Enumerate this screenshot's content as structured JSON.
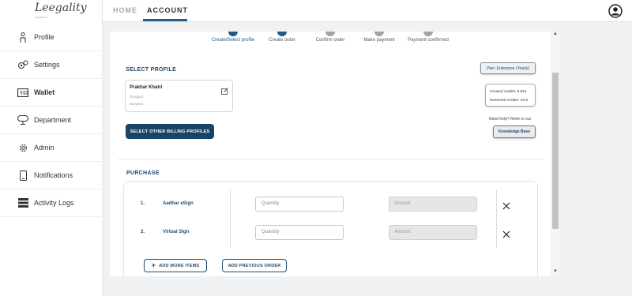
{
  "app": {
    "logo_text": "Leegality",
    "logo_sub": "LEEGALITY"
  },
  "sidebar": {
    "items": [
      {
        "label": "Profile",
        "icon": "person-icon"
      },
      {
        "label": "Settings",
        "icon": "gear-icon"
      },
      {
        "label": "Wallet",
        "icon": "wallet-icon",
        "active": true
      },
      {
        "label": "Department",
        "icon": "department-icon"
      },
      {
        "label": "Admin",
        "icon": "admin-gear-icon"
      },
      {
        "label": "Notifications",
        "icon": "phone-icon"
      },
      {
        "label": "Activity Logs",
        "icon": "server-icon"
      }
    ]
  },
  "topbar": {
    "home_label": "HOME",
    "account_label": "ACCOUNT",
    "accent": "#2a5f86"
  },
  "steps": [
    {
      "label": "Create/Select profile",
      "state": "done"
    },
    {
      "label": "Create order",
      "state": "done"
    },
    {
      "label": "Confirm order",
      "state": "todo"
    },
    {
      "label": "Make payment",
      "state": "todo"
    },
    {
      "label": "Payment confirmed",
      "state": "todo"
    }
  ],
  "select_profile": {
    "title": "SELECT PROFILE",
    "plan_label": "Plan: Enterprise (Yearly)",
    "profile": {
      "name": "Prakhar Khatri",
      "city": "Gurgaon",
      "state": "Haryana"
    },
    "unused_credits": "Unused credits: 5,551",
    "reserved_credits": "Reserved credits: 10.5",
    "other_profiles_button": "SELECT OTHER BILLING PROFILES",
    "help_text": "Need help? Refer to our",
    "knowledge_base_button": "Knowledge Base"
  },
  "purchase": {
    "title": "PURCHASE",
    "rows": [
      {
        "num": "1.",
        "name": "Aadhar eSign",
        "qty_placeholder": "Quantity",
        "amount_placeholder": "Amount"
      },
      {
        "num": "2.",
        "name": "Virtual Sign",
        "qty_placeholder": "Quantity",
        "amount_placeholder": "Amount"
      }
    ],
    "add_more_button": "ADD MORE ITEMS",
    "add_previous_button": "ADD PREVIOUS ORDER"
  }
}
